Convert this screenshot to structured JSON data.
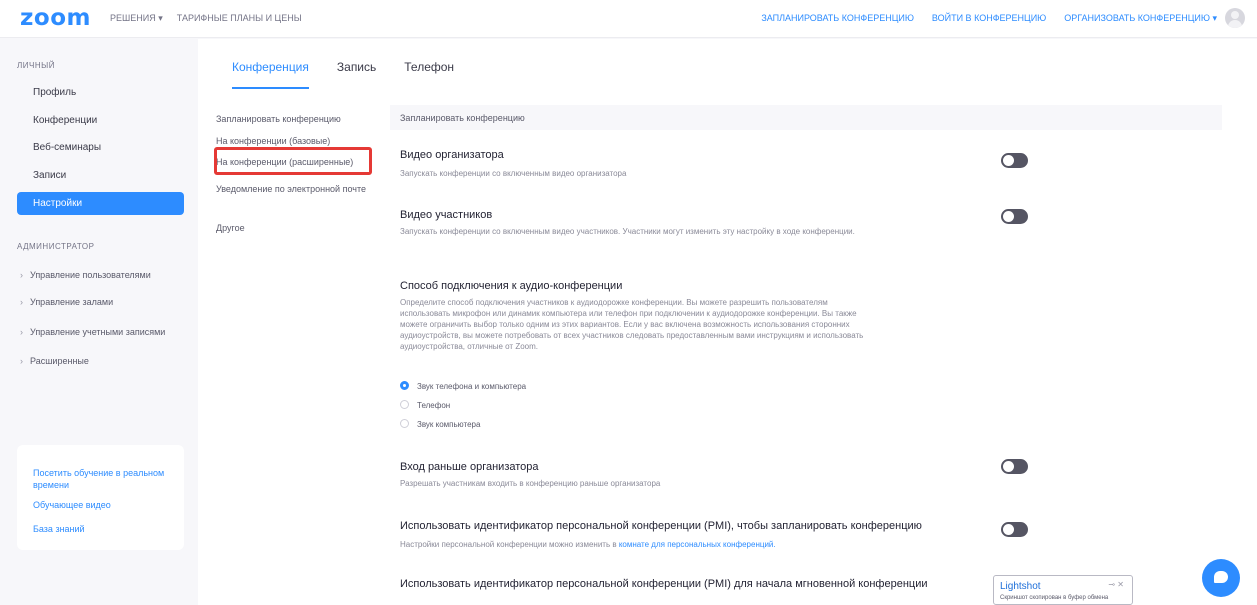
{
  "header": {
    "logo": "zoom",
    "nav_left": [
      "РЕШЕНИЯ ▾",
      "ТАРИФНЫЕ ПЛАНЫ И ЦЕНЫ"
    ],
    "nav_right": [
      "ЗАПЛАНИРОВАТЬ КОНФЕРЕНЦИЮ",
      "ВОЙТИ В КОНФЕРЕНЦИЮ",
      "ОРГАНИЗОВАТЬ КОНФЕРЕНЦИЮ ▾"
    ]
  },
  "sidebar": {
    "personal_label": "ЛИЧНЫЙ",
    "items": [
      "Профиль",
      "Конференции",
      "Веб-семинары",
      "Записи"
    ],
    "active": "Настройки",
    "admin_label": "АДМИНИСТРАТОР",
    "admin_items": [
      "Управление пользователями",
      "Управление залами",
      "Управление учетными записями",
      "Расширенные"
    ],
    "links": [
      "Посетить обучение в реальном времени",
      "Обучающее видео",
      "База знаний"
    ]
  },
  "tabs": [
    "Конференция",
    "Запись",
    "Телефон"
  ],
  "subnav": [
    "Запланировать конференцию",
    "На конференции (базовые)",
    "На конференции (расширенные)",
    "Уведомление по электронной почте",
    "Другое"
  ],
  "section": {
    "header": "Запланировать конференцию",
    "settings": [
      {
        "title": "Видео организатора",
        "desc": "Запускать конференции со включенным видео организатора"
      },
      {
        "title": "Видео участников",
        "desc": "Запускать конференции со включенным видео участников. Участники могут изменить эту настройку в ходе конференции."
      },
      {
        "title": "Способ подключения к аудио-конференции",
        "desc": "Определите способ подключения участников к аудиодорожке конференции. Вы можете разрешить пользователям использовать микрофон или динамик компьютера или телефон при подключении к аудиодорожке конференции. Вы также можете ограничить выбор только одним из этих вариантов. Если у вас включена возможность использования сторонних аудиоустройств, вы можете потребовать от всех участников следовать предоставленным вами инструкциям и использовать аудиоустройства, отличные от Zoom."
      },
      {
        "title": "Вход раньше организатора",
        "desc": "Разрешать участникам входить в конференцию раньше организатора"
      },
      {
        "title": "Использовать идентификатор персональной конференции (PMI), чтобы запланировать конференцию",
        "desc": "Настройки персональной конференции можно изменить в ",
        "link": "комнате для персональных конференций."
      },
      {
        "title": "Использовать идентификатор персональной конференции (PMI) для начала мгновенной конференции"
      }
    ],
    "audio_options": [
      "Звук телефона и компьютера",
      "Телефон",
      "Звук компьютера"
    ]
  },
  "lightshot": {
    "title": "Lightshot",
    "subtitle": "Скриншот скопирован в буфер обмена",
    "controls": "⊸ ✕"
  }
}
